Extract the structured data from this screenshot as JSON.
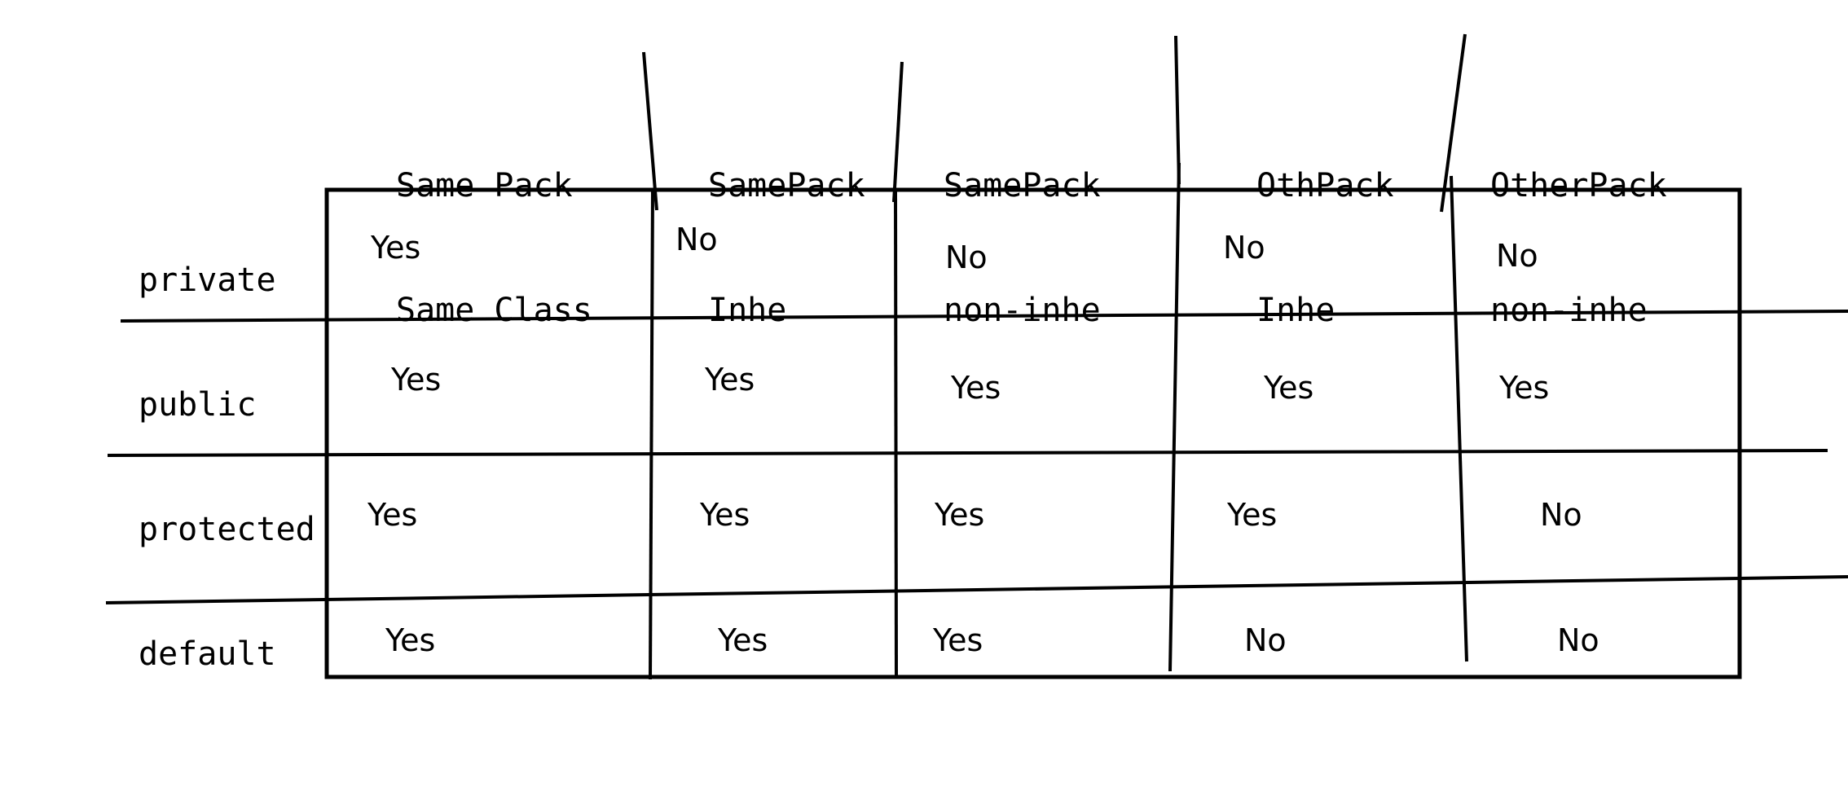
{
  "columns": [
    {
      "line1": "Same Pack",
      "line2": "Same Class"
    },
    {
      "line1": "SamePack",
      "line2": "Inhe"
    },
    {
      "line1": "SamePack",
      "line2": "non-inhe"
    },
    {
      "line1": "OthPack",
      "line2": "Inhe"
    },
    {
      "line1": "OtherPack",
      "line2": "non-inhe"
    }
  ],
  "rows": [
    {
      "label": "private",
      "cells": [
        "Yes",
        "No",
        "No",
        "No",
        "No"
      ]
    },
    {
      "label": "public",
      "cells": [
        "Yes",
        "Yes",
        "Yes",
        "Yes",
        "Yes"
      ]
    },
    {
      "label": "protected",
      "cells": [
        "Yes",
        "Yes",
        "Yes",
        "Yes",
        "No"
      ]
    },
    {
      "label": "default",
      "cells": [
        "Yes",
        "Yes",
        "Yes",
        "No",
        "No"
      ]
    }
  ]
}
